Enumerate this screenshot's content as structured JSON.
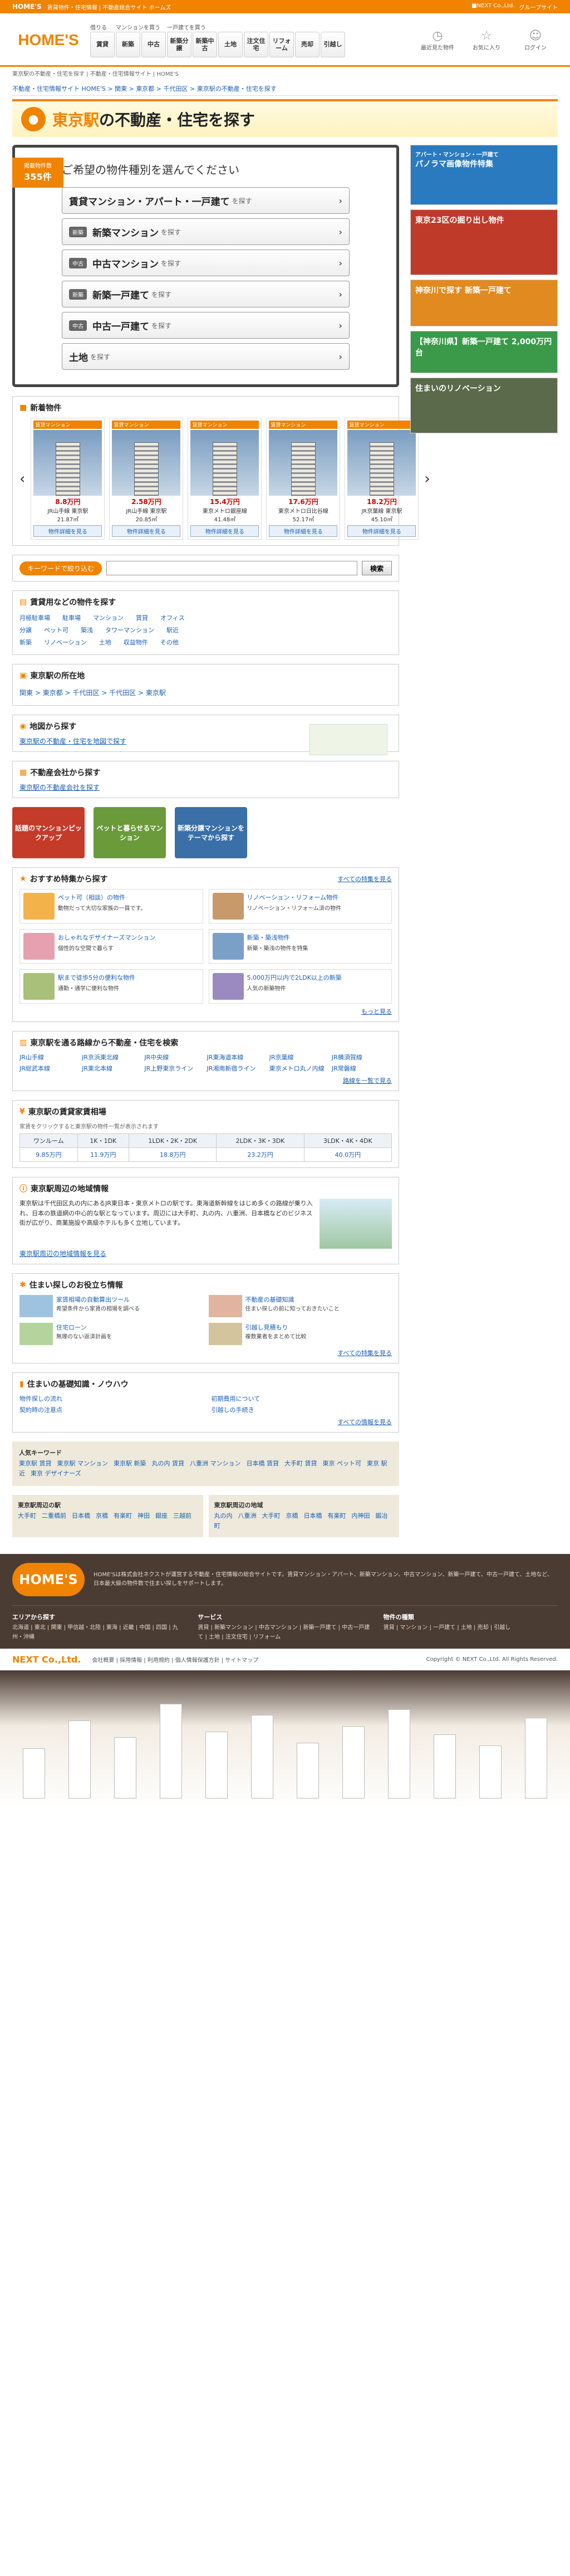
{
  "topbar": {
    "logo": "HOME'S",
    "links": "賃貸物件・住宅情報 | 不動産総合サイト ホームズ",
    "r1": "■NEXT Co.,Ltd.",
    "r2": "グループサイト"
  },
  "header": {
    "logo": "HOME'S",
    "nav": [
      {
        "label": "借りる",
        "btns": [
          "賃貸"
        ]
      },
      {
        "label": "マンションを買う",
        "btns": [
          "新築",
          "中古"
        ]
      },
      {
        "label": "一戸建てを買う",
        "btns": [
          "新築分譲",
          "新築中古"
        ]
      },
      {
        "label": "",
        "btns": [
          "土地",
          "注文住宅",
          "リフォーム",
          "売却",
          "引越し"
        ]
      }
    ],
    "icons": [
      {
        "icon": "clock",
        "label": "最近見た物件"
      },
      {
        "icon": "star",
        "label": "お気に入り"
      },
      {
        "icon": "user",
        "label": "ログイン"
      }
    ]
  },
  "crumbs": "東京駅の不動産・住宅を探す | 不動産・住宅情報サイト | HOME'S",
  "subnav": [
    "不動産・住宅情報サイト HOME'S",
    "関東",
    "東京都",
    "千代田区",
    "東京駅の不動産・住宅を探す"
  ],
  "banner": {
    "title_a": "東京駅",
    "title_b": "の不動産・住宅を探す"
  },
  "typebox": {
    "badge_sm": "掲載物件数",
    "badge_big": "355件",
    "heading": "ご希望の物件種別を選んでください",
    "items": [
      {
        "tag": "",
        "label": "賃貸マンション・アパート・一戸建て",
        "sfx": "を探す"
      },
      {
        "tag": "新築",
        "label": "新築マンション",
        "sfx": "を探す"
      },
      {
        "tag": "中古",
        "label": "中古マンション",
        "sfx": "を探す"
      },
      {
        "tag": "新築",
        "label": "新築一戸建て",
        "sfx": "を探す"
      },
      {
        "tag": "中古",
        "label": "中古一戸建て",
        "sfx": "を探す"
      },
      {
        "tag": "",
        "label": "土地",
        "sfx": "を探す"
      }
    ]
  },
  "new_props": {
    "title": "新着物件",
    "detail": "物件詳細を見る",
    "cards": [
      {
        "tag": "賃貸マンション",
        "price": "8.8万円",
        "loc": "JR山手線 東京駅",
        "size": "21.87㎡"
      },
      {
        "tag": "賃貸マンション",
        "price": "2.58万円",
        "loc": "JR山手線 東京駅",
        "size": "20.85㎡"
      },
      {
        "tag": "賃貸マンション",
        "price": "15.4万円",
        "loc": "東京メトロ銀座線",
        "size": "41.48㎡"
      },
      {
        "tag": "賃貸マンション",
        "price": "17.6万円",
        "loc": "東京メトロ日比谷線",
        "size": "52.17㎡"
      },
      {
        "tag": "賃貸マンション",
        "price": "18.2万円",
        "loc": "JR京葉線 東京駅",
        "size": "45.10㎡"
      }
    ]
  },
  "keyword": {
    "label": "キーワードで絞り込む",
    "placeholder": "",
    "button": "検索"
  },
  "conditions": {
    "title": "賃貸用などの物件を探す",
    "rows": [
      [
        "月極駐車場",
        "駐車場",
        "マンション",
        "賃貸",
        "オフィス"
      ],
      [
        "分譲",
        "ペット可",
        "築浅",
        "タワーマンション",
        "駅近"
      ],
      [
        "新築",
        "リノベーション",
        "土地",
        "収益物件",
        "その他"
      ]
    ]
  },
  "station": {
    "title": "東京駅の所在地",
    "path": [
      "関東",
      "東京都",
      "千代田区",
      "千代田区",
      "東京駅"
    ]
  },
  "map": {
    "title": "地図から探す",
    "link": "東京駅の不動産・住宅を地図で探す"
  },
  "agents": {
    "title": "不動産会社から探す",
    "link": "東京駅の不動産会社を探す"
  },
  "picks": [
    "話題のマンションピックアップ",
    "ペットと暮らせるマンション",
    "新築分譲マンションをテーマから探す"
  ],
  "features": {
    "title": "おすすめ特集から探す",
    "all": "すべての特集を見る",
    "items": [
      {
        "title": "ペット可（相談）の物件",
        "desc": "動物だって大切な家族の一員です。"
      },
      {
        "title": "リノベーション・リフォーム物件",
        "desc": "リノベーション・リフォーム済の物件"
      },
      {
        "title": "おしゃれなデザイナーズマンション",
        "desc": "個性的な空間で暮らす"
      },
      {
        "title": "新築・築浅物件",
        "desc": "新築・築浅の物件を特集"
      },
      {
        "title": "駅まで徒歩5分の便利な物件",
        "desc": "通勤・通学に便利な物件"
      },
      {
        "title": "5,000万円以内で2LDK以上の新築",
        "desc": "人気の新築物件"
      }
    ],
    "more": "もっと見る"
  },
  "lines": {
    "title": "東京駅を通る路線から不動産・住宅を検索",
    "items": [
      "JR山手線",
      "JR京浜東北線",
      "JR中央線",
      "JR東海道本線",
      "JR京葉線",
      "JR横須賀線",
      "JR総武本線",
      "JR東北本線",
      "JR上野東京ライン",
      "JR湘南新宿ライン",
      "東京メトロ丸ノ内線",
      "JR常磐線"
    ],
    "more": "路線を一覧で見る"
  },
  "rent": {
    "title": "東京駅の賃貸家賃相場",
    "note": "家賃をクリックすると東京駅の物件一覧が表示されます",
    "headers": [
      "ワンルーム",
      "1K・1DK",
      "1LDK・2K・2DK",
      "2LDK・3K・3DK",
      "3LDK・4K・4DK"
    ],
    "values": [
      "9.85万円",
      "11.9万円",
      "18.8万円",
      "23.2万円",
      "40.0万円"
    ]
  },
  "area": {
    "title": "東京駅周辺の地域情報",
    "text": "東京駅は千代田区丸の内にあるJR東日本・東京メトロの駅です。東海道新幹線をはじめ多くの路線が乗り入れ、日本の鉄道網の中心的な駅となっています。周辺には大手町、丸の内、八重洲、日本橋などのビジネス街が広がり、商業施設や高級ホテルも多く立地しています。",
    "link": "東京駅周辺の地域情報を見る"
  },
  "useful": {
    "title": "住まい探しのお役立ち情報",
    "items": [
      {
        "title": "家賃相場の自動算出ツール",
        "desc": "希望条件から家賃の相場を調べる"
      },
      {
        "title": "不動産の基礎知識",
        "desc": "住まい探しの前に知っておきたいこと"
      },
      {
        "title": "住宅ローン",
        "desc": "無理のない返済計画を"
      },
      {
        "title": "引越し見積もり",
        "desc": "複数業者をまとめて比較"
      }
    ],
    "all": "すべての特集を見る"
  },
  "knowhow": {
    "title": "住まいの基礎知識・ノウハウ",
    "items": [
      "物件探しの流れ",
      "初期費用について",
      "契約時の注意点",
      "引越しの手続き"
    ],
    "all": "すべての情報を見る"
  },
  "popular": {
    "title": "人気キーワード",
    "items": [
      "東京駅 賃貸",
      "東京駅 マンション",
      "東京駅 新築",
      "丸の内 賃貸",
      "八重洲 マンション",
      "日本橋 賃貸",
      "大手町 賃貸",
      "東京 ペット可",
      "東京 駅近",
      "東京 デザイナーズ"
    ]
  },
  "nearby": {
    "title1": "東京駅周辺の駅",
    "items1": [
      "大手町",
      "二重橋前",
      "日本橋",
      "京橋",
      "有楽町",
      "神田",
      "銀座",
      "三越前"
    ],
    "title2": "東京駅周辺の地域",
    "items2": [
      "丸の内",
      "八重洲",
      "大手町",
      "京橋",
      "日本橋",
      "有楽町",
      "内神田",
      "鍛冶町"
    ]
  },
  "sidebar": [
    {
      "title": "アパート・マンション・一戸建て",
      "label": "パノラマ画像物件特集"
    },
    {
      "title": "",
      "label": "東京23区の掘り出し物件"
    },
    {
      "title": "",
      "label": "神奈川で探す 新築一戸建て"
    },
    {
      "title": "",
      "label": "【神奈川県】新築一戸建て 2,000万円台"
    },
    {
      "title": "",
      "label": "住まいのリノベーション"
    }
  ],
  "footer": {
    "logo": "HOME'S",
    "about": "HOME'Sは株式会社ネクストが運営する不動産・住宅情報の総合サイトです。賃貸マンション・アパート、新築マンション、中古マンション、新築一戸建て、中古一戸建て、土地など、日本最大級の物件数で住まい探しをサポートします。",
    "cols": [
      {
        "h": "エリアから探す",
        "t": "北海道 | 東北 | 関東 | 甲信越・北陸 | 東海 | 近畿 | 中国 | 四国 | 九州・沖縄"
      },
      {
        "h": "サービス",
        "t": "賃貸 | 新築マンション | 中古マンション | 新築一戸建て | 中古一戸建て | 土地 | 注文住宅 | リフォーム"
      },
      {
        "h": "物件の種類",
        "t": "賃貸 | マンション | 一戸建て | 土地 | 売却 | 引越し"
      }
    ],
    "company": "NEXT Co.,Ltd.",
    "bottom": "会社概要 | 採用情報 | 利用規約 | 個人情報保護方針 | サイトマップ",
    "copy": "Copyright © NEXT Co.,Ltd. All Rights Reserved."
  }
}
